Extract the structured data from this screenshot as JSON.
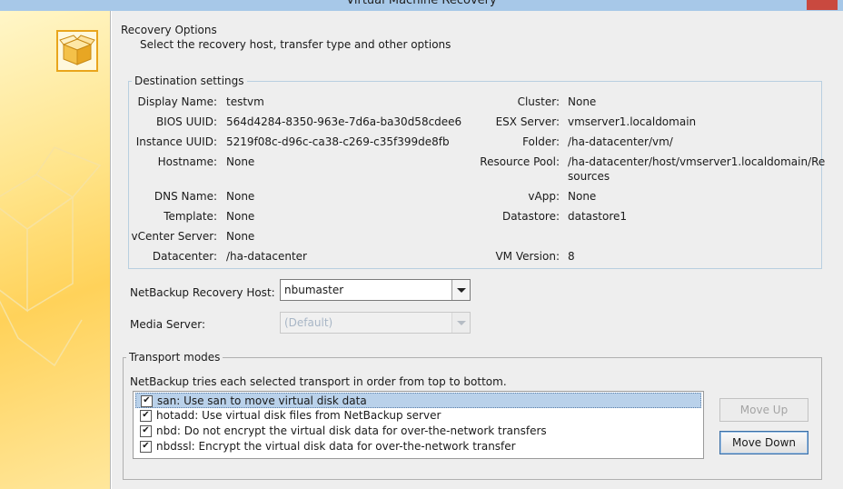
{
  "window": {
    "title": "Virtual Machine Recovery"
  },
  "header": {
    "title": "Recovery Options",
    "subtitle": "Select the recovery host, transfer type and other options"
  },
  "destination": {
    "legend": "Destination settings",
    "left": [
      {
        "label": "Display Name:",
        "value": "testvm"
      },
      {
        "label": "BIOS UUID:",
        "value": "564d4284-8350-963e-7d6a-ba30d58cdee6"
      },
      {
        "label": "Instance UUID:",
        "value": "5219f08c-d96c-ca38-c269-c35f399de8fb"
      },
      {
        "label": "Hostname:",
        "value": "None"
      },
      {
        "label": "DNS Name:",
        "value": "None"
      },
      {
        "label": "Template:",
        "value": "None"
      },
      {
        "label": "vCenter Server:",
        "value": "None"
      },
      {
        "label": "Datacenter:",
        "value": "/ha-datacenter"
      }
    ],
    "right": [
      {
        "label": "Cluster:",
        "value": "None"
      },
      {
        "label": "ESX Server:",
        "value": "vmserver1.localdomain"
      },
      {
        "label": "Folder:",
        "value": "/ha-datacenter/vm/"
      },
      {
        "label": "Resource Pool:",
        "value": "/ha-datacenter/host/vmserver1.localdomain/Re",
        "value2": "sources"
      },
      {
        "label": "vApp:",
        "value": "None"
      },
      {
        "label": "Datastore:",
        "value": "datastore1"
      },
      {
        "label": "VM Version:",
        "value": "8"
      }
    ]
  },
  "recovery_host": {
    "label": "NetBackup Recovery Host:",
    "value": "nbumaster"
  },
  "media_server": {
    "label": "Media Server:",
    "value": "(Default)"
  },
  "transport": {
    "legend": "Transport modes",
    "description": "NetBackup tries each selected transport in order from top to bottom.",
    "items": [
      {
        "text": "san: Use san to move virtual disk data",
        "checked": true
      },
      {
        "text": "hotadd: Use virtual disk files from NetBackup server",
        "checked": true
      },
      {
        "text": "nbd: Do not encrypt the virtual disk data for over-the-network transfers",
        "checked": true
      },
      {
        "text": "nbdssl: Encrypt the virtual disk data for over-the-network transfer",
        "checked": true
      }
    ],
    "check_glyph": "✔",
    "move_up": "Move Up",
    "move_down": "Move Down"
  }
}
